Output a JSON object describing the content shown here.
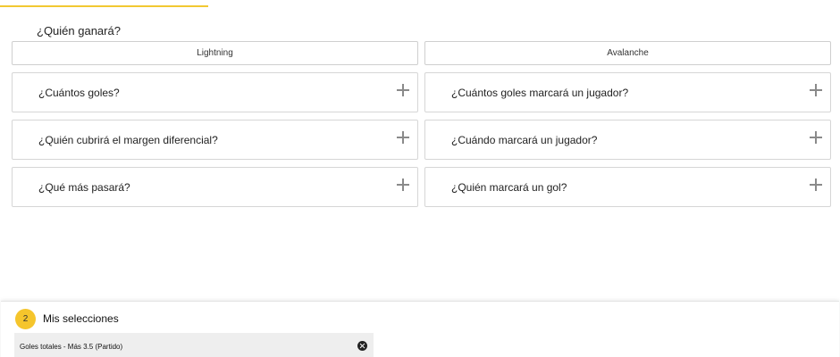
{
  "winner": {
    "question": "¿Quién ganará?",
    "teams": [
      "Lightning",
      "Avalanche"
    ]
  },
  "markets": {
    "left": [
      {
        "label": "¿Cuántos goles?"
      },
      {
        "label": "¿Quién cubrirá el margen diferencial?"
      },
      {
        "label": "¿Qué más pasará?"
      }
    ],
    "right": [
      {
        "label": "¿Cuántos goles marcará un jugador?"
      },
      {
        "label": "¿Cuándo marcará un jugador?"
      },
      {
        "label": "¿Quién marcará un gol?"
      }
    ]
  },
  "betslip": {
    "count": "2",
    "title": "Mis selecciones",
    "selection": "Goles totales - Más 3.5 (Partido)"
  },
  "colors": {
    "accent": "#f2c832",
    "badge": "#f5c52c",
    "border": "#d6d6d6",
    "selection_bg": "#eeeeee"
  },
  "icons": {
    "expand": "plus-icon",
    "remove": "close-circle-icon"
  }
}
